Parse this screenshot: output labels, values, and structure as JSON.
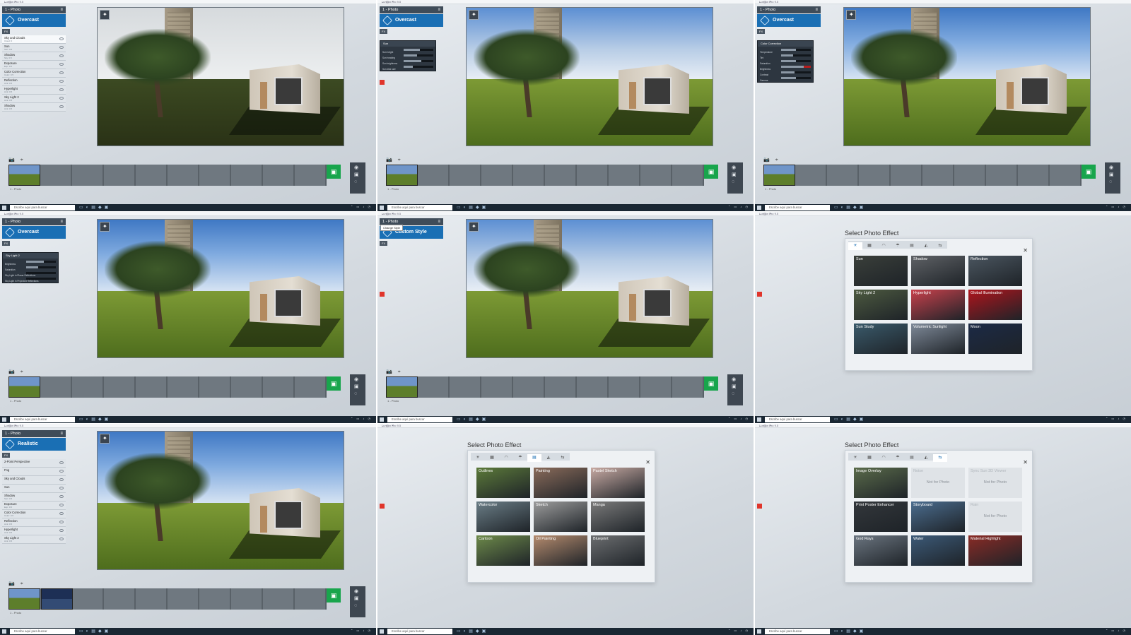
{
  "app": {
    "title_bar": "Lumion Pro 9.5",
    "panel_title": "1 - Photo",
    "fx_tag": "FX",
    "taskbar_search": "Escribe aquí para buscar",
    "thumb_label": "1 - Photo"
  },
  "cells": [
    {
      "style_label": "Overcast",
      "sky": "gray",
      "effects": [
        {
          "label": "Sky and Clouds",
          "sub": "Cloud: 0",
          "selected": true
        },
        {
          "label": "Sun",
          "sub": "Sun: 0.5"
        },
        {
          "label": "Shadow",
          "sub": "Sky: 0.5"
        },
        {
          "label": "Exposure",
          "sub": "Exp: 0.5"
        },
        {
          "label": "Color Correction",
          "sub": "Color: 0.5"
        },
        {
          "label": "Reflection",
          "sub": "Amt: 0.5"
        },
        {
          "label": "Hyperlight",
          "sub": "Amt: 0.5"
        },
        {
          "label": "Sky Light 2",
          "sub": "Amt: 0.5"
        },
        {
          "label": "Shadow",
          "sub": "Amt: 0.5"
        }
      ]
    },
    {
      "style_label": "Overcast",
      "sky": "cloud",
      "sub_panel": {
        "title": "Sun",
        "rows": [
          {
            "label": "Sun height",
            "value": 0.55
          },
          {
            "label": "Sun heading",
            "value": 0.45
          },
          {
            "label": "Sun brightness",
            "value": 0.6
          },
          {
            "label": "Sun disk size",
            "value": 0.3
          }
        ]
      }
    },
    {
      "style_label": "Overcast",
      "sky": "blue",
      "sub_panel": {
        "title": "Color Correction",
        "rows": [
          {
            "label": "Temperature",
            "value": 0.5
          },
          {
            "label": "Tint",
            "value": 0.4
          },
          {
            "label": "Saturation",
            "value": 0.5
          },
          {
            "label": "Brightness",
            "value": 0.75,
            "hot": true
          },
          {
            "label": "Contrast",
            "value": 0.45
          },
          {
            "label": "Gamma",
            "value": 0.5
          }
        ]
      }
    },
    {
      "style_label": "Overcast",
      "sky": "blue",
      "sub_panel": {
        "title": "Sky Light 2",
        "rows": [
          {
            "label": "Brightness",
            "value": 0.6
          },
          {
            "label": "Saturation",
            "value": 0.4
          },
          {
            "label": "Sky Light in Planar Reflections",
            "value": 0.0
          },
          {
            "label": "Sky Light in Projected Reflections",
            "value": 0.0
          }
        ]
      }
    },
    {
      "style_label": "Custom Style",
      "sky": "cloud",
      "tooltip": "Change Style"
    },
    {
      "dialog_title": "Select Photo Effect",
      "tiles": [
        {
          "label": "Sun",
          "color": "#3a3f3a"
        },
        {
          "label": "Shadow",
          "color": "#5f6266"
        },
        {
          "label": "Reflection",
          "color": "#4b5660"
        },
        {
          "label": "Sky Light 2",
          "color": "#4d5a40"
        },
        {
          "label": "Hyperlight",
          "color": "#c9414c"
        },
        {
          "label": "Global Illumination",
          "color": "#b0141c"
        },
        {
          "label": "Sun Study",
          "color": "#3a5a6b"
        },
        {
          "label": "Volumetric Sunlight",
          "color": "#7f8a99"
        },
        {
          "label": "Moon",
          "color": "#1c2a46"
        }
      ]
    },
    {
      "style_label": "Realistic",
      "sky": "blue",
      "effects": [
        {
          "label": "2-Point Perspective",
          "sub": ""
        },
        {
          "label": "Fog",
          "sub": ""
        },
        {
          "label": "Sky and Clouds",
          "sub": ""
        },
        {
          "label": "Sun",
          "sub": ""
        },
        {
          "label": "Shadow",
          "sub": "Sun: 0.5"
        },
        {
          "label": "Exposure",
          "sub": "Exp: 0.5"
        },
        {
          "label": "Color Correction",
          "sub": "Color: 0.5"
        },
        {
          "label": "Reflection",
          "sub": "Amt: 0.5"
        },
        {
          "label": "Hyperlight",
          "sub": "Amt: 0.5"
        },
        {
          "label": "Sky Light 2",
          "sub": "Amt: 0.5"
        }
      ]
    },
    {
      "dialog_title": "Select Photo Effect",
      "tiles": [
        {
          "label": "Outlines",
          "color": "#5c7a3a"
        },
        {
          "label": "Painting",
          "color": "#8a6b5a"
        },
        {
          "label": "Pastel Sketch",
          "color": "#c8aaa3"
        },
        {
          "label": "Watercolor",
          "color": "#6a7d86"
        },
        {
          "label": "Sketch",
          "color": "#9c9c9c"
        },
        {
          "label": "Manga",
          "color": "#7a7a7a"
        },
        {
          "label": "Cartoon",
          "color": "#6d8a4a"
        },
        {
          "label": "Oil Painting",
          "color": "#b58b6e"
        },
        {
          "label": "Blueprint",
          "color": "#6c6e70"
        }
      ]
    },
    {
      "dialog_title": "Select Photo Effect",
      "tiles": [
        {
          "label": "Image Overlay",
          "color": "#5a6b4a"
        },
        {
          "label": "Noise",
          "color": "#dfe3e7",
          "note": "Not for Photo",
          "disabled": true
        },
        {
          "label": "Sync Sun 3D Viewer",
          "color": "#dfe3e7",
          "note": "Not for Photo",
          "disabled": true
        },
        {
          "label": "Print Poster Enhancer",
          "color": "#33373b"
        },
        {
          "label": "Storyboard",
          "color": "#4b6d8f"
        },
        {
          "label": "Rain",
          "color": "#dfe3e7",
          "note": "Not for Photo",
          "disabled": true
        },
        {
          "label": "God Rays",
          "color": "#6b7580"
        },
        {
          "label": "Water",
          "color": "#3c5a78"
        },
        {
          "label": "Material Highlight",
          "color": "#8a2b26"
        }
      ]
    }
  ]
}
